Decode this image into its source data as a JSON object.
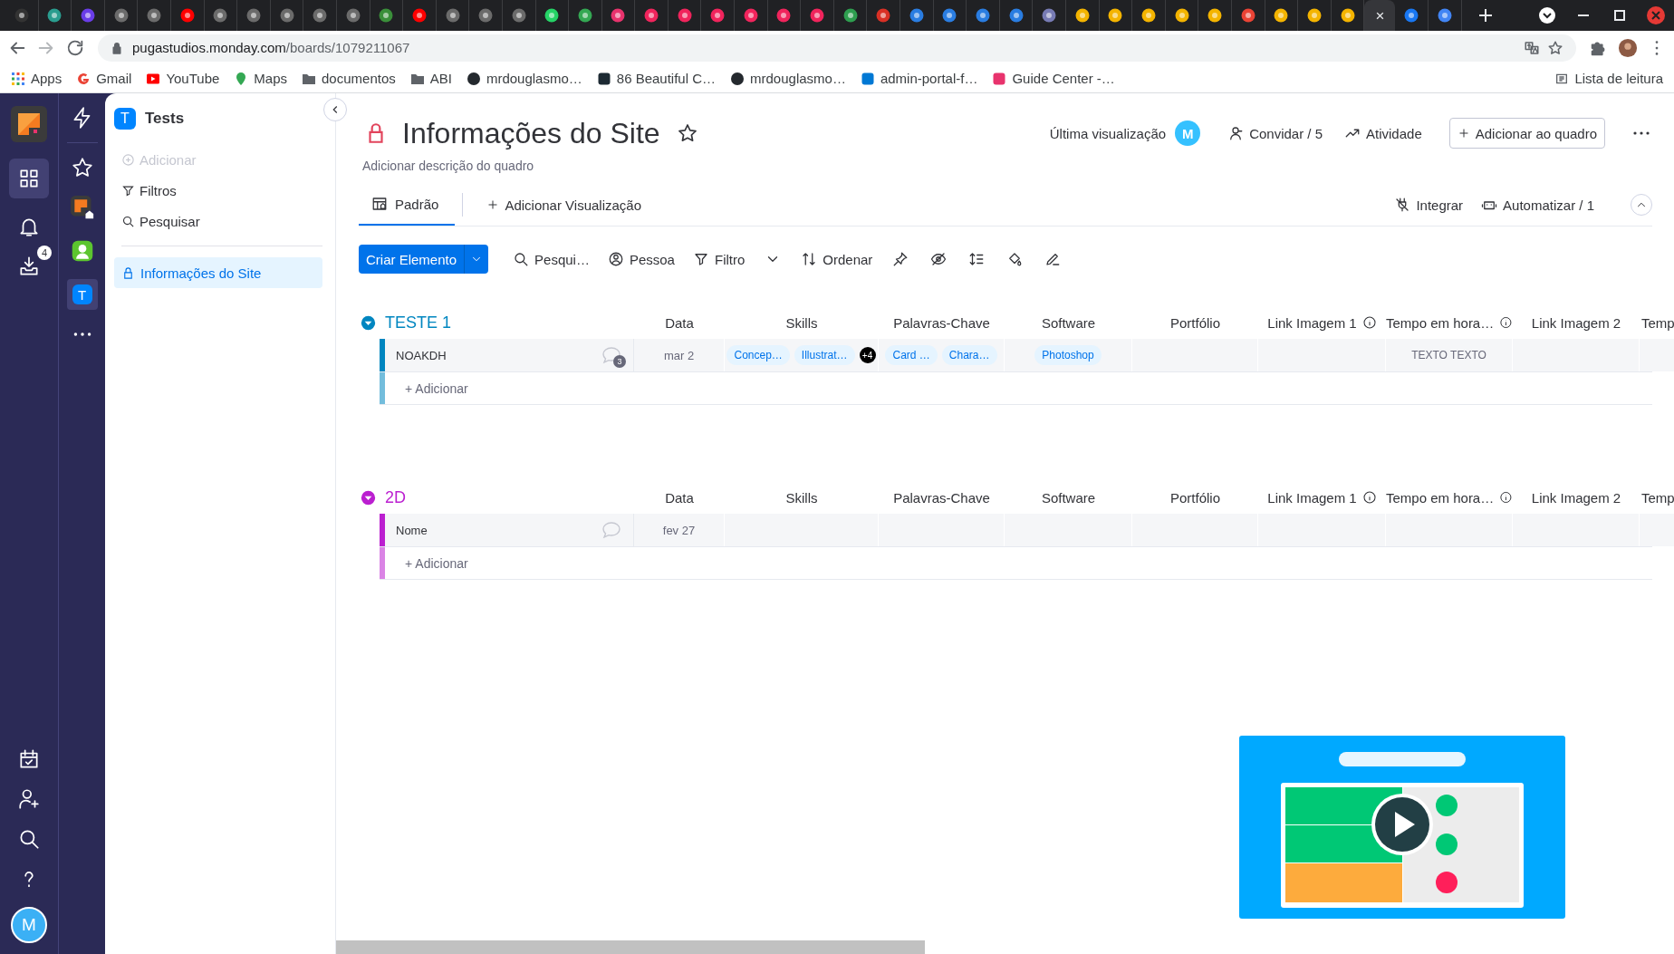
{
  "browser": {
    "tabs": [
      {
        "color": "#333333",
        "selected": false
      },
      {
        "color": "#2a9d8f",
        "selected": false
      },
      {
        "color": "#6a3de8",
        "selected": false
      },
      {
        "color": "#6b6b6b",
        "selected": false
      },
      {
        "color": "#6b6b6b",
        "selected": false
      },
      {
        "color": "#ff0000",
        "selected": false
      },
      {
        "color": "#6b6b6b",
        "selected": false
      },
      {
        "color": "#6b6b6b",
        "selected": false
      },
      {
        "color": "#6b6b6b",
        "selected": false
      },
      {
        "color": "#6b6b6b",
        "selected": false
      },
      {
        "color": "#6b6b6b",
        "selected": false
      },
      {
        "color": "#3a8f3a",
        "selected": false
      },
      {
        "color": "#ff0000",
        "selected": false
      },
      {
        "color": "#6b6b6b",
        "selected": false
      },
      {
        "color": "#6b6b6b",
        "selected": false
      },
      {
        "color": "#6b6b6b",
        "selected": false
      },
      {
        "color": "#25d366",
        "selected": false
      },
      {
        "color": "#34a853",
        "selected": false
      },
      {
        "color": "#e8336d",
        "selected": false
      },
      {
        "color": "#f0245c",
        "selected": false
      },
      {
        "color": "#f0245c",
        "selected": false
      },
      {
        "color": "#f0245c",
        "selected": false
      },
      {
        "color": "#f0245c",
        "selected": false
      },
      {
        "color": "#f0245c",
        "selected": false
      },
      {
        "color": "#f0245c",
        "selected": false
      },
      {
        "color": "#2e9e4f",
        "selected": false
      },
      {
        "color": "#d93025",
        "selected": false
      },
      {
        "color": "#2a7de1",
        "selected": false
      },
      {
        "color": "#2a7de1",
        "selected": false
      },
      {
        "color": "#2a7de1",
        "selected": false
      },
      {
        "color": "#2a7de1",
        "selected": false
      },
      {
        "color": "#777bb4",
        "selected": false
      },
      {
        "color": "#f4b400",
        "selected": false
      },
      {
        "color": "#f4b400",
        "selected": false
      },
      {
        "color": "#f4b400",
        "selected": false
      },
      {
        "color": "#f4b400",
        "selected": false
      },
      {
        "color": "#f4b400",
        "selected": false
      },
      {
        "color": "#ea4335",
        "selected": false
      },
      {
        "color": "#f4b400",
        "selected": false
      },
      {
        "color": "#f4b400",
        "selected": false
      },
      {
        "color": "#f4b400",
        "selected": false
      },
      {
        "selected": true,
        "close": "×"
      },
      {
        "color": "#1877f2",
        "selected": false
      },
      {
        "color": "#4285f4",
        "selected": false
      }
    ],
    "url_host": "pugastudios.monday.com",
    "url_path": "/boards/1079211067",
    "bookmarks": [
      {
        "label": "Apps",
        "kind": "apps"
      },
      {
        "label": "Gmail",
        "kind": "google"
      },
      {
        "label": "YouTube",
        "kind": "youtube"
      },
      {
        "label": "Maps",
        "kind": "maps"
      },
      {
        "label": "documentos",
        "kind": "folder"
      },
      {
        "label": "ABI",
        "kind": "folder"
      },
      {
        "label": "mrdouglasmo…",
        "kind": "github"
      },
      {
        "label": "86 Beautiful C…",
        "kind": "site"
      },
      {
        "label": "mrdouglasmo…",
        "kind": "github"
      },
      {
        "label": "admin-portal-f…",
        "kind": "azure"
      },
      {
        "label": "Guide Center -…",
        "kind": "brand"
      }
    ],
    "reading_list": "Lista de leitura"
  },
  "rail": {
    "badge": "4",
    "avatar": "M"
  },
  "workspaces": [
    {
      "kind": "logo",
      "selected": false
    },
    {
      "kind": "person",
      "selected": false
    },
    {
      "kind": "letter",
      "letter": "T",
      "selected": true
    }
  ],
  "sidebar": {
    "workspace": "Tests",
    "workspace_letter": "T",
    "actions": [
      {
        "label": "Adicionar",
        "kind": "add",
        "disabled": true
      },
      {
        "label": "Filtros",
        "kind": "filter",
        "disabled": false
      },
      {
        "label": "Pesquisar",
        "kind": "search",
        "disabled": false
      }
    ],
    "boards": [
      {
        "label": "Informações do Site",
        "selected": true
      }
    ]
  },
  "board": {
    "title": "Informações do Site",
    "description": "Adicionar descrição do quadro",
    "last_seen": "Última visualização",
    "viewer": "M",
    "invite": "Convidar / 5",
    "activity": "Atividade",
    "add_to_board": "Adicionar ao quadro"
  },
  "views": {
    "tabs": [
      {
        "label": "Padrão",
        "selected": true
      }
    ],
    "add": "Adicionar Visualização",
    "integrate": "Integrar",
    "automate": "Automatizar / 1"
  },
  "toolbar": {
    "create": "Criar Elemento",
    "search": "Pesqui…",
    "person": "Pessoa",
    "filter": "Filtro",
    "sort": "Ordenar"
  },
  "groups": [
    {
      "title": "TESTE 1",
      "color": "#0086c0",
      "add": "+ Adicionar",
      "columns": [
        {
          "title": "Data",
          "info": false
        },
        {
          "title": "Skills",
          "info": false
        },
        {
          "title": "Palavras-Chave",
          "info": false
        },
        {
          "title": "Software",
          "info": false
        },
        {
          "title": "Portfólio",
          "info": false
        },
        {
          "title": "Link Imagem 1",
          "info": true
        },
        {
          "title": "Tempo em hora…",
          "info": true
        },
        {
          "title": "Link Imagem 2",
          "info": false
        },
        {
          "title": "Temp",
          "info": false
        }
      ],
      "items": [
        {
          "name": "NOAKDH",
          "updates": "3",
          "cells": [
            {
              "kind": "date",
              "text": "mar 2"
            },
            {
              "kind": "tags",
              "tags": [
                "Concep…",
                "Illustrat…"
              ],
              "more": "+4"
            },
            {
              "kind": "tags",
              "tags": [
                "Card …",
                "Chara…"
              ]
            },
            {
              "kind": "tags",
              "tags": [
                "Photoshop"
              ]
            },
            {
              "kind": "empty"
            },
            {
              "kind": "empty"
            },
            {
              "kind": "text",
              "text": "TEXTO TEXTO"
            },
            {
              "kind": "empty"
            },
            {
              "kind": "empty"
            }
          ]
        }
      ]
    },
    {
      "title": "2D",
      "color": "#bb1fd0",
      "add": "+ Adicionar",
      "columns": [
        {
          "title": "Data",
          "info": false
        },
        {
          "title": "Skills",
          "info": false
        },
        {
          "title": "Palavras-Chave",
          "info": false
        },
        {
          "title": "Software",
          "info": false
        },
        {
          "title": "Portfólio",
          "info": false
        },
        {
          "title": "Link Imagem 1",
          "info": true
        },
        {
          "title": "Tempo em hora…",
          "info": true
        },
        {
          "title": "Link Imagem 2",
          "info": false
        },
        {
          "title": "Temp",
          "info": false
        }
      ],
      "items": [
        {
          "name": "Nome",
          "cells": [
            {
              "kind": "date",
              "text": "fev 27"
            },
            {
              "kind": "empty"
            },
            {
              "kind": "empty"
            },
            {
              "kind": "empty"
            },
            {
              "kind": "empty"
            },
            {
              "kind": "empty"
            },
            {
              "kind": "empty"
            },
            {
              "kind": "empty"
            },
            {
              "kind": "empty"
            }
          ]
        }
      ]
    }
  ]
}
